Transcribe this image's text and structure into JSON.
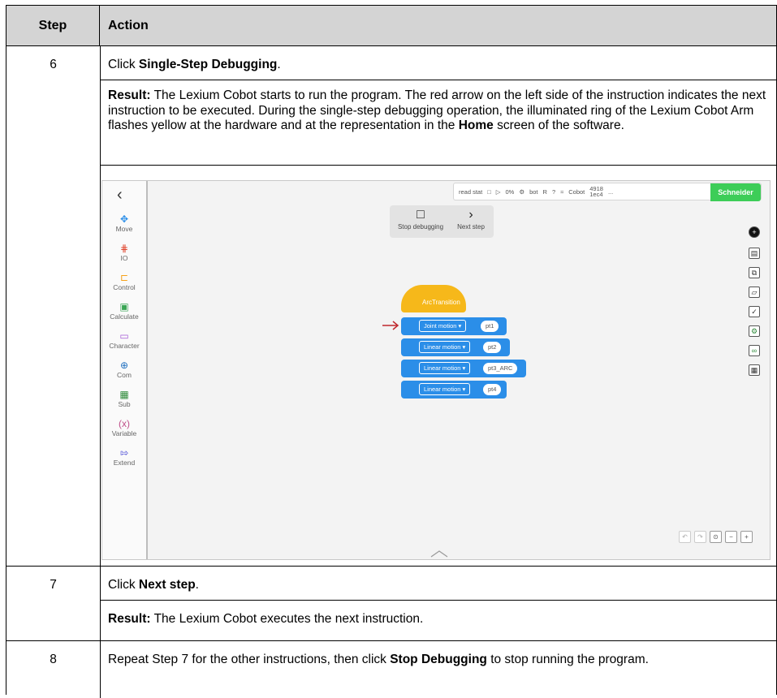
{
  "table": {
    "header_step": "Step",
    "header_action": "Action"
  },
  "row6": {
    "step": "6",
    "instruction_prefix": "Click ",
    "instruction_bold": "Single-Step Debugging",
    "instruction_suffix": ".",
    "result_label": "Result:",
    "result_text_1": " The Lexium Cobot starts to run the program. The red arrow on the left side of the instruction indicates the next instruction to be executed. During the single-step debugging operation, the illuminated ring of the Lexium Cobot Arm flashes yellow at the hardware and at the representation in the ",
    "result_bold": "Home",
    "result_text_2": " screen of the software."
  },
  "row7": {
    "step": "7",
    "instruction_prefix": "Click ",
    "instruction_bold": "Next step",
    "instruction_suffix": ".",
    "result_label": "Result:",
    "result_text": " The Lexium Cobot executes the next instruction."
  },
  "row8": {
    "step": "8",
    "text_1": "Repeat Step 7 for the other instructions, then click ",
    "bold": "Stop Debugging",
    "text_2": " to stop running the program."
  },
  "screenshot": {
    "palette": [
      {
        "label": "Move",
        "icon": "move-icon"
      },
      {
        "label": "IO",
        "icon": "io-icon"
      },
      {
        "label": "Control",
        "icon": "control-icon"
      },
      {
        "label": "Calculate",
        "icon": "calculate-icon"
      },
      {
        "label": "Character",
        "icon": "character-icon"
      },
      {
        "label": "Com",
        "icon": "globe-icon"
      },
      {
        "label": "Sub",
        "icon": "grid-icon"
      },
      {
        "label": "Variable",
        "icon": "variable-icon"
      },
      {
        "label": "Extend",
        "icon": "extend-icon"
      }
    ],
    "topbar": {
      "read_stat": "read stat",
      "percent": "0%",
      "bot": "bot",
      "r": "R",
      "cobot": "Cobot",
      "cobot_id_top": "4918",
      "cobot_id_bottom": "1ec4",
      "more": "...",
      "brand": "Schneider"
    },
    "debug": {
      "stop_label": "Stop debugging",
      "next_label": "Next step"
    },
    "program": {
      "hat_label": "ArcTransition",
      "blocks": [
        {
          "motion": "Joint motion ▾",
          "point": "pt1"
        },
        {
          "motion": "Linear motion ▾",
          "point": "pt2"
        },
        {
          "motion": "Linear motion ▾",
          "point": "pt3_ARC"
        },
        {
          "motion": "Linear motion ▾",
          "point": "pt4"
        }
      ]
    },
    "colors": {
      "block_blue": "#2b8ee8",
      "hat_yellow": "#f6b81a",
      "arrow_red": "#c0282d",
      "brand_green": "#3dcd58"
    }
  }
}
